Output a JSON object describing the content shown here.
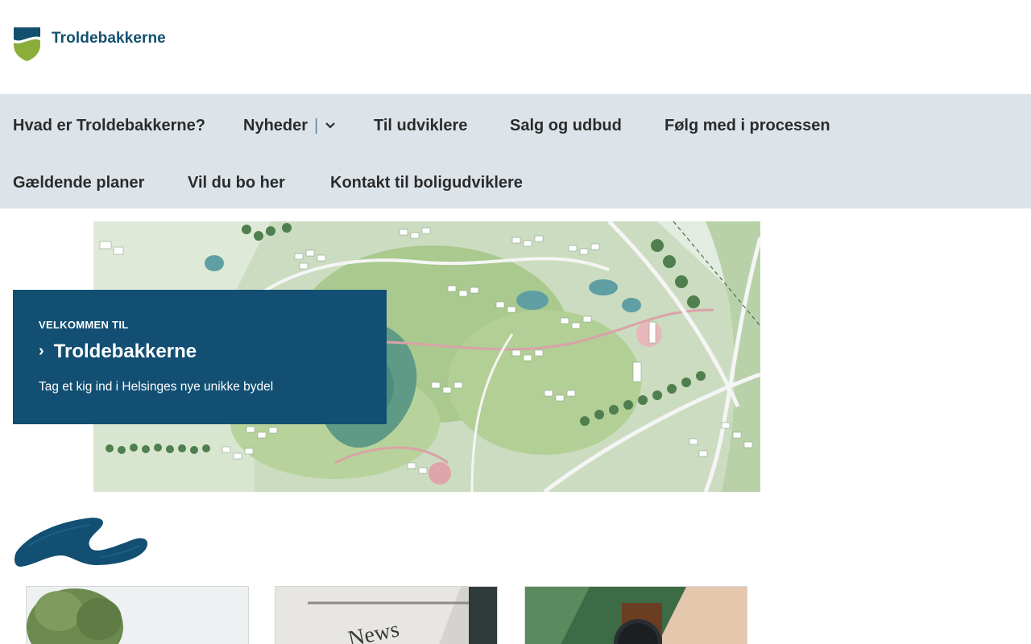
{
  "header": {
    "logo_text": "Troldebakkerne",
    "logo_colors": {
      "blue": "#13506f",
      "green": "#8bae3b"
    }
  },
  "nav": {
    "background": "#dde4e9",
    "row1": [
      {
        "label": "Hvad er Troldebakkerne?"
      },
      {
        "label": "Nyheder",
        "has_dropdown": true
      },
      {
        "label": "Til udviklere"
      },
      {
        "label": "Salg og udbud"
      },
      {
        "label": "Følg med i processen"
      }
    ],
    "row2": [
      {
        "label": "Gældende planer"
      },
      {
        "label": "Vil du bo her"
      },
      {
        "label": "Kontakt til boligudviklere"
      }
    ],
    "separator": "|"
  },
  "hero": {
    "image": "aerial-masterplan-map",
    "kicker": "VELKOMMEN TIL",
    "title": "Troldebakkerne",
    "subtitle": "Tag et kig ind i Helsinges nye unikke bydel",
    "panel_color": "#124f73"
  },
  "cards": [
    {
      "image": "trees-photo"
    },
    {
      "image": "newspaper-photo"
    },
    {
      "image": "wristwatch-photo"
    }
  ]
}
